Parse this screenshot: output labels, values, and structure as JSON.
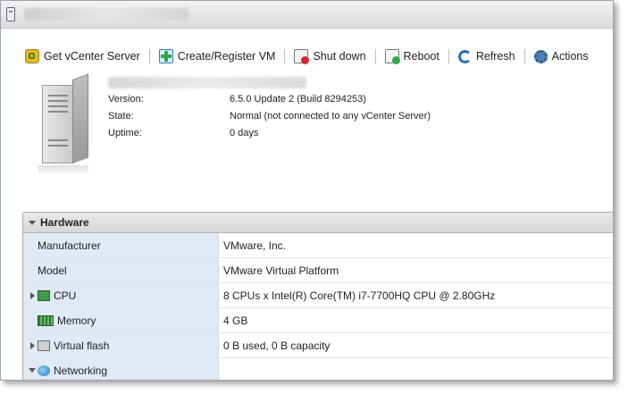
{
  "toolbar": {
    "get_vcenter": "Get vCenter Server",
    "create_register": "Create/Register VM",
    "shut_down": "Shut down",
    "reboot": "Reboot",
    "refresh": "Refresh",
    "actions": "Actions"
  },
  "summary": {
    "version_label": "Version:",
    "version_value": "6.5.0 Update 2 (Build 8294253)",
    "state_label": "State:",
    "state_value": "Normal (not connected to any vCenter Server)",
    "uptime_label": "Uptime:",
    "uptime_value": "0 days"
  },
  "hardware": {
    "title": "Hardware",
    "rows": [
      {
        "label": "Manufacturer",
        "value": "VMware, Inc."
      },
      {
        "label": "Model",
        "value": "VMware Virtual Platform"
      },
      {
        "label": "CPU",
        "value": "8 CPUs x Intel(R) Core(TM) i7-7700HQ CPU @ 2.80GHz"
      },
      {
        "label": "Memory",
        "value": "4 GB"
      },
      {
        "label": "Virtual flash",
        "value": "0 B used, 0 B capacity"
      },
      {
        "label": "Networking",
        "value": ""
      }
    ]
  },
  "icons": {
    "get_vcenter": "vcenter-icon",
    "create_register": "register-vm-icon",
    "shut_down": "power-off-icon",
    "reboot": "reboot-icon",
    "refresh": "refresh-icon",
    "actions": "gear-icon"
  }
}
